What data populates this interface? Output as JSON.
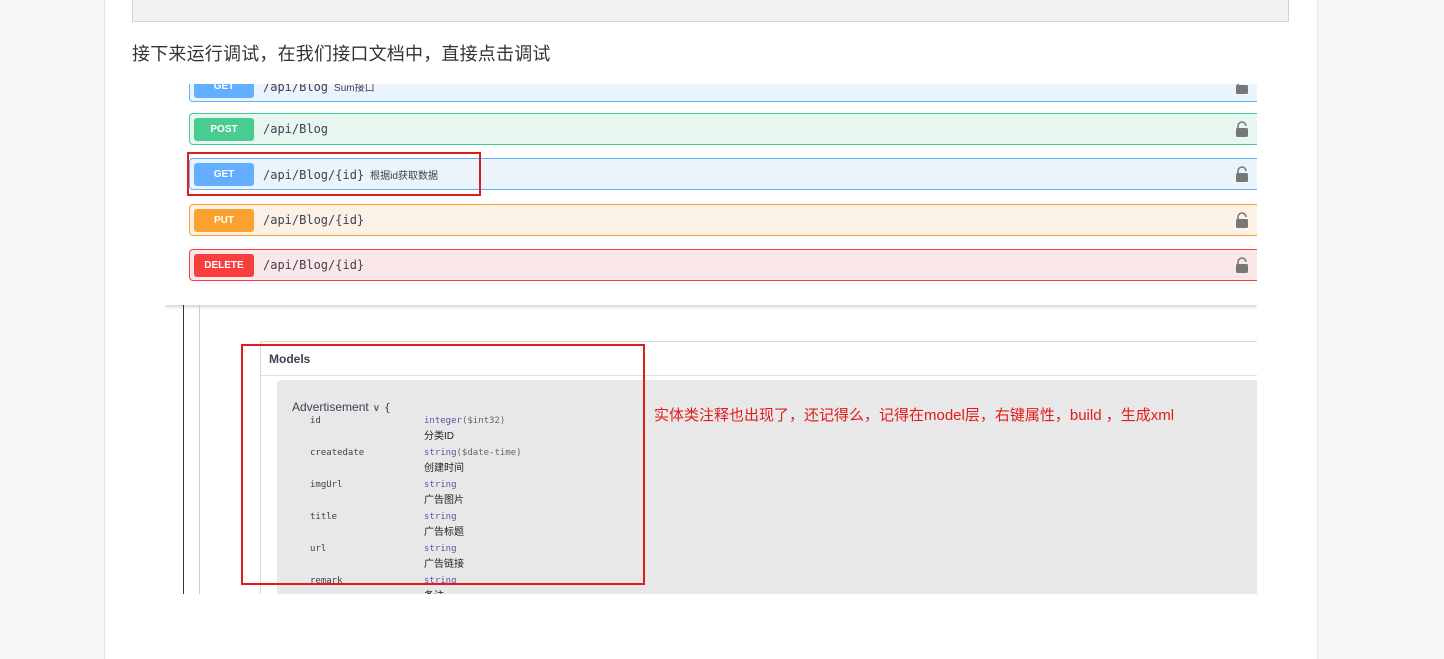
{
  "intro_text": "接下来运行调试，在我们接口文档中，直接点击调试",
  "operations": [
    {
      "method": "GET",
      "path": "/api/Blog",
      "desc": "Sum接口"
    },
    {
      "method": "POST",
      "path": "/api/Blog",
      "desc": ""
    },
    {
      "method": "GET",
      "path": "/api/Blog/{id}",
      "desc": "根据id获取数据"
    },
    {
      "method": "PUT",
      "path": "/api/Blog/{id}",
      "desc": ""
    },
    {
      "method": "DELETE",
      "path": "/api/Blog/{id}",
      "desc": ""
    }
  ],
  "models": {
    "title": "Models",
    "model_name": "Advertisement",
    "brace": "{",
    "properties": [
      {
        "name": "id",
        "type": "integer",
        "format": "($int32)",
        "desc": "分类ID"
      },
      {
        "name": "createdate",
        "type": "string",
        "format": "($date-time)",
        "desc": "创建时间"
      },
      {
        "name": "imgUrl",
        "type": "string",
        "format": "",
        "desc": "广告图片"
      },
      {
        "name": "title",
        "type": "string",
        "format": "",
        "desc": "广告标题"
      },
      {
        "name": "url",
        "type": "string",
        "format": "",
        "desc": "广告链接"
      },
      {
        "name": "remark",
        "type": "string",
        "format": "",
        "desc": "备注"
      }
    ]
  },
  "annotation": "实体类注释也出现了，还记得么，记得在model层，右键属性，build ，生成xml",
  "colors": {
    "get": "#61affe",
    "post": "#49cc90",
    "put": "#fca130",
    "delete": "#f93e3e",
    "annotation_red": "#e21b1b"
  },
  "icons": {
    "lock": "lock-icon",
    "chevron": "chevron-down-icon"
  }
}
